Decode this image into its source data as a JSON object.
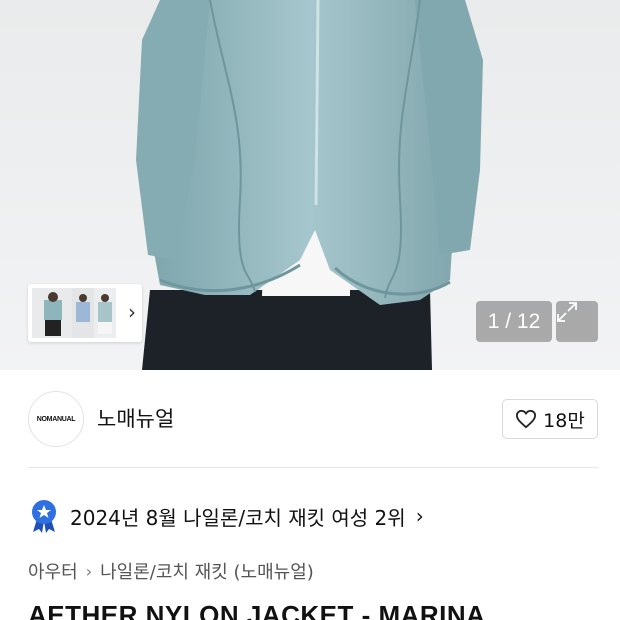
{
  "gallery": {
    "counter": "1 / 12",
    "expand_icon": "expand-icon",
    "thumb_chevron": "›"
  },
  "brand": {
    "logo_text": "NOMANUAL",
    "name": "노매뉴얼",
    "likes": "18만",
    "like_icon": "heart-icon"
  },
  "ranking": {
    "badge_icon": "rank-badge-icon",
    "text": "2024년 8월 나일론/코치 재킷 여성 2위",
    "chevron": "›"
  },
  "breadcrumb": {
    "items": [
      "아우터",
      "나일론/코치 재킷 (노매뉴얼)"
    ],
    "separator": "›"
  },
  "product": {
    "title": "AETHER NYLON JACKET - MARINA"
  },
  "colors": {
    "jacket": "#8fb5bc",
    "background": "#eef0f1",
    "accent_badge": "#2f6fe0"
  }
}
